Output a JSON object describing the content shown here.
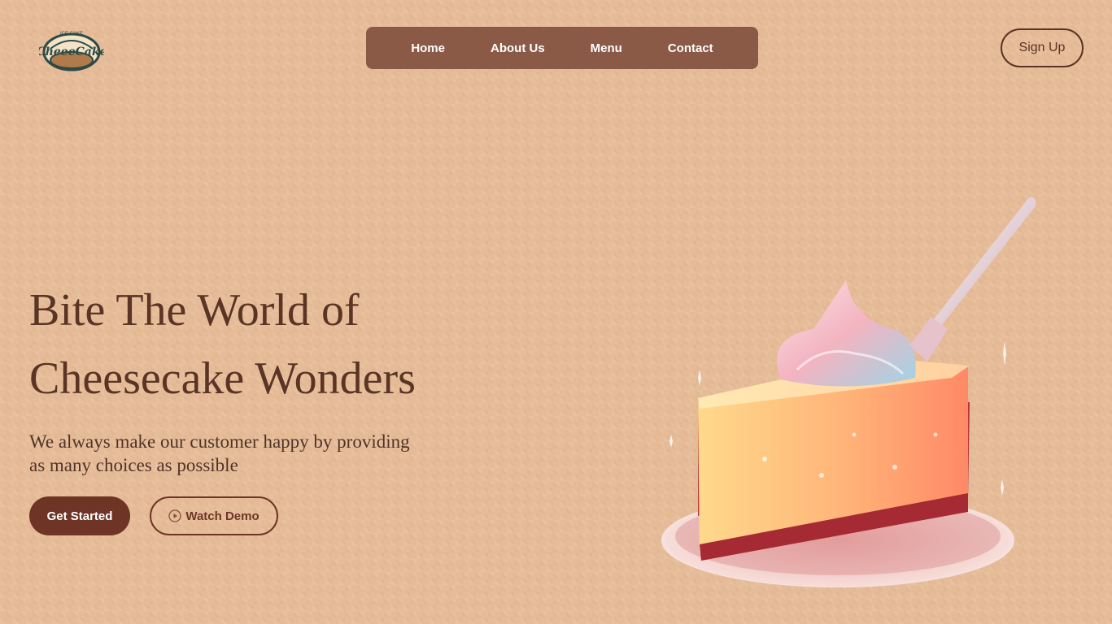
{
  "logo": {
    "top_text": "ICE CAKE",
    "word": "CheeeCake"
  },
  "nav": {
    "items": [
      {
        "label": "Home"
      },
      {
        "label": "About Us"
      },
      {
        "label": "Menu"
      },
      {
        "label": "Contact"
      }
    ]
  },
  "header": {
    "signup_label": "Sign Up"
  },
  "hero": {
    "title_line1": "Bite The World of",
    "title_line2": "Cheesecake Wonders",
    "subtitle_line1": "We always make our customer happy by providing",
    "subtitle_line2": "as many choices as possible",
    "primary_button": "Get Started",
    "secondary_button": "Watch Demo",
    "secondary_icon": "play-circle-icon"
  },
  "colors": {
    "background": "#e6bc98",
    "nav_bg": "#8a5a47",
    "accent_dark": "#6e3526",
    "text_brown": "#5a3425"
  }
}
